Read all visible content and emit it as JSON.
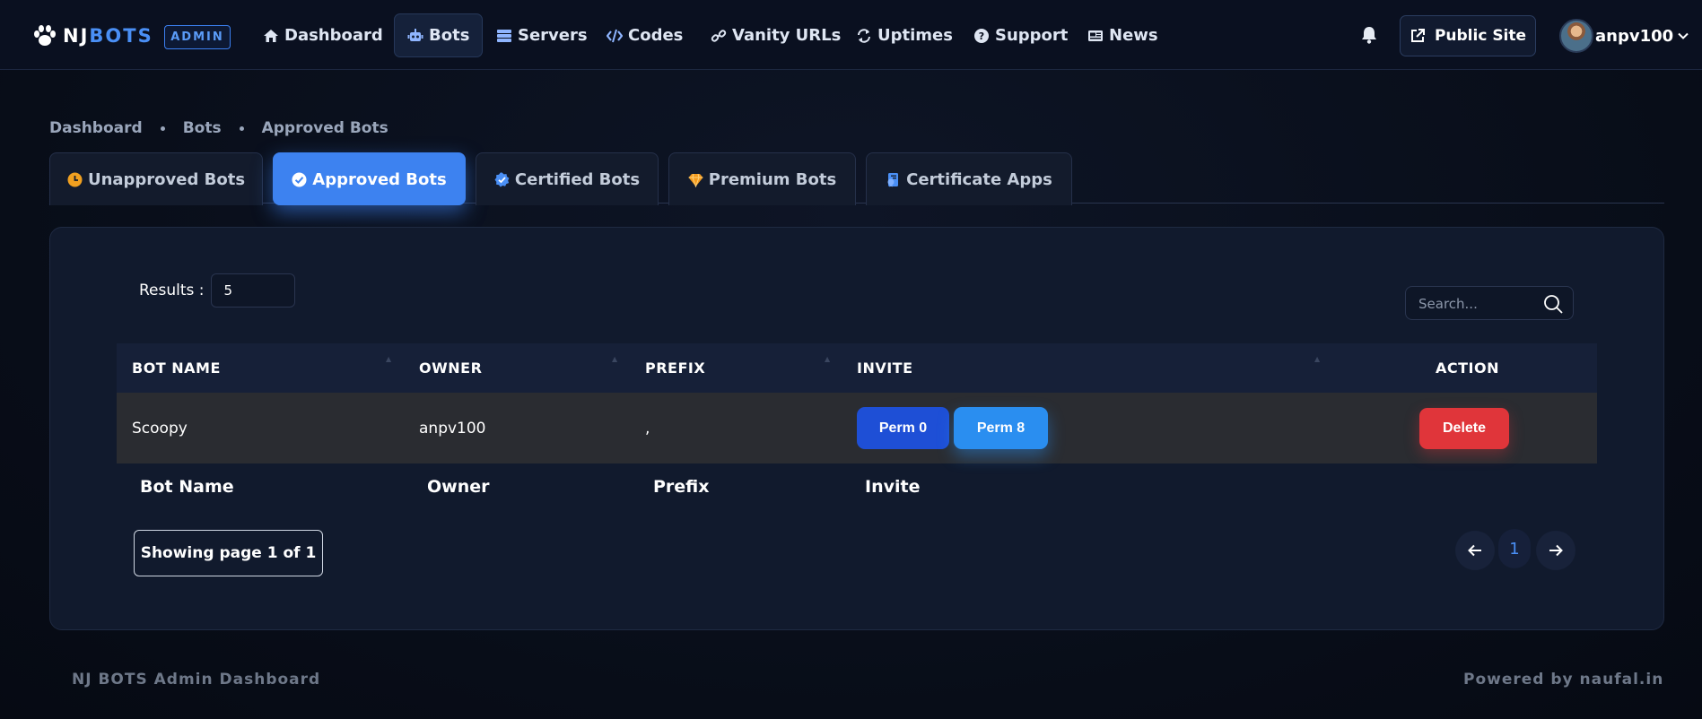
{
  "header": {
    "brand_part1": "NJ",
    "brand_part2": "BOTS",
    "admin_badge": "ADMIN",
    "nav": [
      {
        "label": "Dashboard",
        "icon": "home-icon"
      },
      {
        "label": "Bots",
        "icon": "robot-icon",
        "active": true
      },
      {
        "label": "Servers",
        "icon": "server-icon"
      },
      {
        "label": "Codes",
        "icon": "code-icon"
      },
      {
        "label": "Vanity URLs",
        "icon": "link-icon"
      },
      {
        "label": "Uptimes",
        "icon": "sync-icon"
      },
      {
        "label": "Support",
        "icon": "question-icon"
      },
      {
        "label": "News",
        "icon": "newspaper-icon"
      }
    ],
    "public_site": "Public Site",
    "username": "anpv100"
  },
  "breadcrumb": [
    "Dashboard",
    "Bots",
    "Approved Bots"
  ],
  "tabs": [
    {
      "label": "Unapproved Bots",
      "icon": "clock-icon"
    },
    {
      "label": "Approved Bots",
      "icon": "check-circle-icon",
      "active": true
    },
    {
      "label": "Certified Bots",
      "icon": "verified-badge-icon"
    },
    {
      "label": "Premium Bots",
      "icon": "gem-icon"
    },
    {
      "label": "Certificate Apps",
      "icon": "certificate-icon"
    }
  ],
  "table": {
    "results_label": "Results :",
    "results_value": "5",
    "search_placeholder": "Search...",
    "columns": [
      "BOT NAME",
      "OWNER",
      "PREFIX",
      "INVITE",
      "ACTION"
    ],
    "rows": [
      {
        "bot_name": "Scoopy",
        "owner": "anpv100",
        "prefix": ",",
        "invite": [
          "Perm 0",
          "Perm 8"
        ],
        "action": "Delete"
      }
    ],
    "footer_columns": [
      "Bot Name",
      "Owner",
      "Prefix",
      "Invite"
    ],
    "showing": "Showing page 1 of 1",
    "current_page": "1"
  },
  "footer": {
    "left": "NJ BOTS Admin Dashboard",
    "right": "Powered by naufal.in"
  },
  "colors": {
    "accent": "#3d82f0",
    "danger": "#e0353a",
    "background": "#080d18",
    "card": "#111a2d"
  }
}
